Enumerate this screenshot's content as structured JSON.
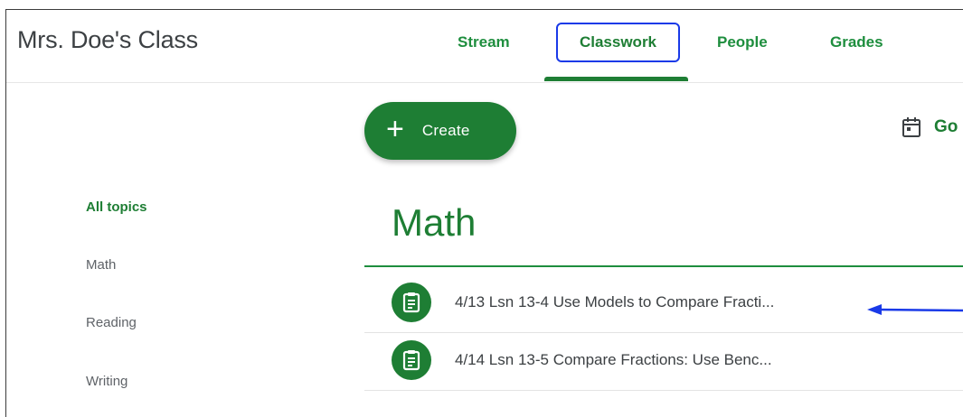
{
  "header": {
    "class_name": "Mrs. Doe's Class",
    "tabs": [
      {
        "label": "Stream"
      },
      {
        "label": "Classwork"
      },
      {
        "label": "People"
      },
      {
        "label": "Grades"
      }
    ],
    "active_tab": "Classwork"
  },
  "toolbar": {
    "create_label": "Create",
    "calendar_link_label": "Go"
  },
  "topics": [
    {
      "label": "All topics"
    },
    {
      "label": "Math"
    },
    {
      "label": "Reading"
    },
    {
      "label": "Writing"
    }
  ],
  "section": {
    "title": "Math",
    "assignments": [
      {
        "title": "4/13 Lsn 13-4 Use Models to Compare Fracti..."
      },
      {
        "title": "4/14 Lsn 13-5 Compare Fractions: Use Benc..."
      }
    ]
  },
  "colors": {
    "brand_green": "#1e7e34",
    "highlight_blue": "#1a3ae8"
  },
  "icons": {
    "create": "plus-icon",
    "calendar": "calendar-icon",
    "assignment": "assignment-icon",
    "annotation": "arrow-left-icon"
  }
}
